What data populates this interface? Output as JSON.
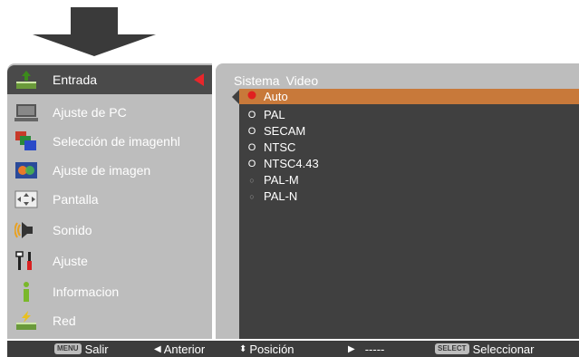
{
  "menu": {
    "items": [
      {
        "label": "Entrada",
        "icon": "input-icon"
      },
      {
        "label": "Ajuste de PC",
        "icon": "pc-adjust-icon"
      },
      {
        "label": "Selección de imagenhl",
        "icon": "image-select-icon"
      },
      {
        "label": "Ajuste de imagen",
        "icon": "image-adjust-icon"
      },
      {
        "label": "Pantalla",
        "icon": "screen-icon"
      },
      {
        "label": "Sonido",
        "icon": "sound-icon"
      },
      {
        "label": "Ajuste",
        "icon": "settings-icon"
      },
      {
        "label": "Informacion",
        "icon": "info-icon"
      },
      {
        "label": "Red",
        "icon": "network-icon"
      }
    ],
    "active_index": 0
  },
  "submenu": {
    "tabs": [
      "Sistema",
      "Video"
    ],
    "options": [
      {
        "label": "Auto",
        "state": "selected"
      },
      {
        "label": "PAL",
        "state": "available"
      },
      {
        "label": "SECAM",
        "state": "available"
      },
      {
        "label": "NTSC",
        "state": "available"
      },
      {
        "label": "NTSC4.43",
        "state": "available"
      },
      {
        "label": "PAL-M",
        "state": "unavailable"
      },
      {
        "label": "PAL-N",
        "state": "unavailable"
      }
    ]
  },
  "footer": {
    "menu_key": "MENU",
    "exit": "Salir",
    "previous": "Anterior",
    "position": "Posición",
    "next": "-----",
    "select_key": "SELECT",
    "select": "Seleccionar"
  },
  "colors": {
    "panel": "#bdbdbd",
    "active_item": "#4a4a4a",
    "list_bg": "#404040",
    "highlight": "#c8793a",
    "selected_dot": "#e02020",
    "marker": "#e8262b"
  }
}
